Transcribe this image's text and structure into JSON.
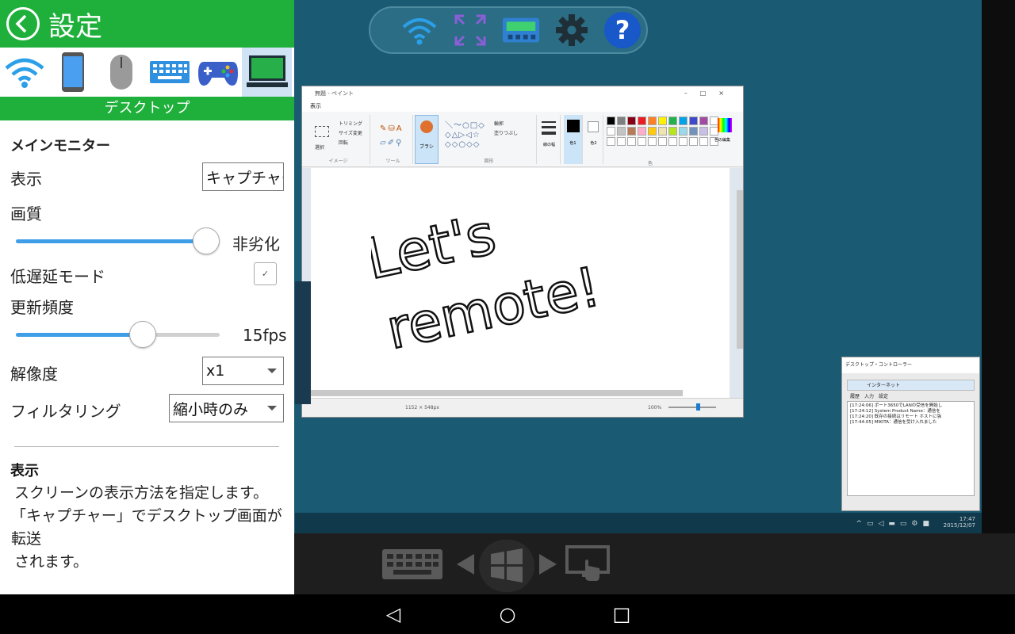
{
  "settings": {
    "title": "設定",
    "section": "デスクトップ",
    "device_icons": [
      "wifi-icon",
      "phone-icon",
      "mouse-icon",
      "keyboard-icon",
      "gamepad-icon",
      "desktop-icon"
    ],
    "main_monitor_label": "メインモニター",
    "display": {
      "label": "表示",
      "value": "キャプチャー"
    },
    "quality": {
      "label": "画質",
      "value_text": "非劣化",
      "fraction": 1.0
    },
    "low_latency": {
      "label": "低遅延モード",
      "checked": true,
      "check_mark": "✓"
    },
    "refresh": {
      "label": "更新頻度",
      "value_text": "15fps",
      "fraction": 0.64
    },
    "resolution": {
      "label": "解像度",
      "value": "x1"
    },
    "filtering": {
      "label": "フィルタリング",
      "value": "縮小時のみ"
    },
    "help": {
      "title": "表示",
      "line1": "スクリーンの表示方法を指定します。",
      "line2": "「キャプチャー」でデスクトップ画面が転送",
      "line3": "されます。"
    }
  },
  "remote_toolbar": {
    "icons": [
      "wifi-icon",
      "fullscreen-icon",
      "gamepad-icon",
      "gear-icon",
      "help-icon"
    ],
    "help_glyph": "?"
  },
  "paint": {
    "title": "無題 - ペイント",
    "tab": "表示",
    "group_image": "イメージ",
    "group_tools": "ツール",
    "group_shapes": "図形",
    "group_colors": "色",
    "trim_label": "トリミング",
    "resize_label": "サイズ変更",
    "rotate_label": "回転",
    "select_label": "選択",
    "brush_label": "ブラシ",
    "outline_label": "輪郭",
    "fill_label": "塗りつぶし",
    "width_label": "線の幅",
    "color1_label": "色1",
    "color2_label": "色2",
    "edit_colors_label": "色の編集",
    "status_size": "1152 × 548px",
    "zoom": "100%",
    "handwriting_line1": "Let's",
    "handwriting_line2": "remote!"
  },
  "controller_window": {
    "title": "デスクトップ・コントローラー",
    "tab_label": "インターネット",
    "menu": "履歴　入力　設定",
    "log": [
      "[17:24:06] ポート3650でLANの受信を開始し",
      "[17:24:12] System Product Name：通信を",
      "[17:24:20] 既存の接続はリモート ホストに強",
      "[17:44:05] MIKITA：通信を受け入れました"
    ]
  },
  "taskbar": {
    "time": "17:47",
    "date": "2015/12/07"
  },
  "bottom_controls": {
    "icons": [
      "keyboard-icon",
      "left-arrow-icon",
      "windows-icon",
      "right-arrow-icon",
      "touch-monitor-icon"
    ]
  },
  "android_nav": {
    "back": "◁",
    "home": "○",
    "recent": "□"
  },
  "colors": {
    "accent_green": "#1fb03c",
    "slider_blue": "#3f9ee8",
    "desktop_teal": "#1a5a72"
  }
}
